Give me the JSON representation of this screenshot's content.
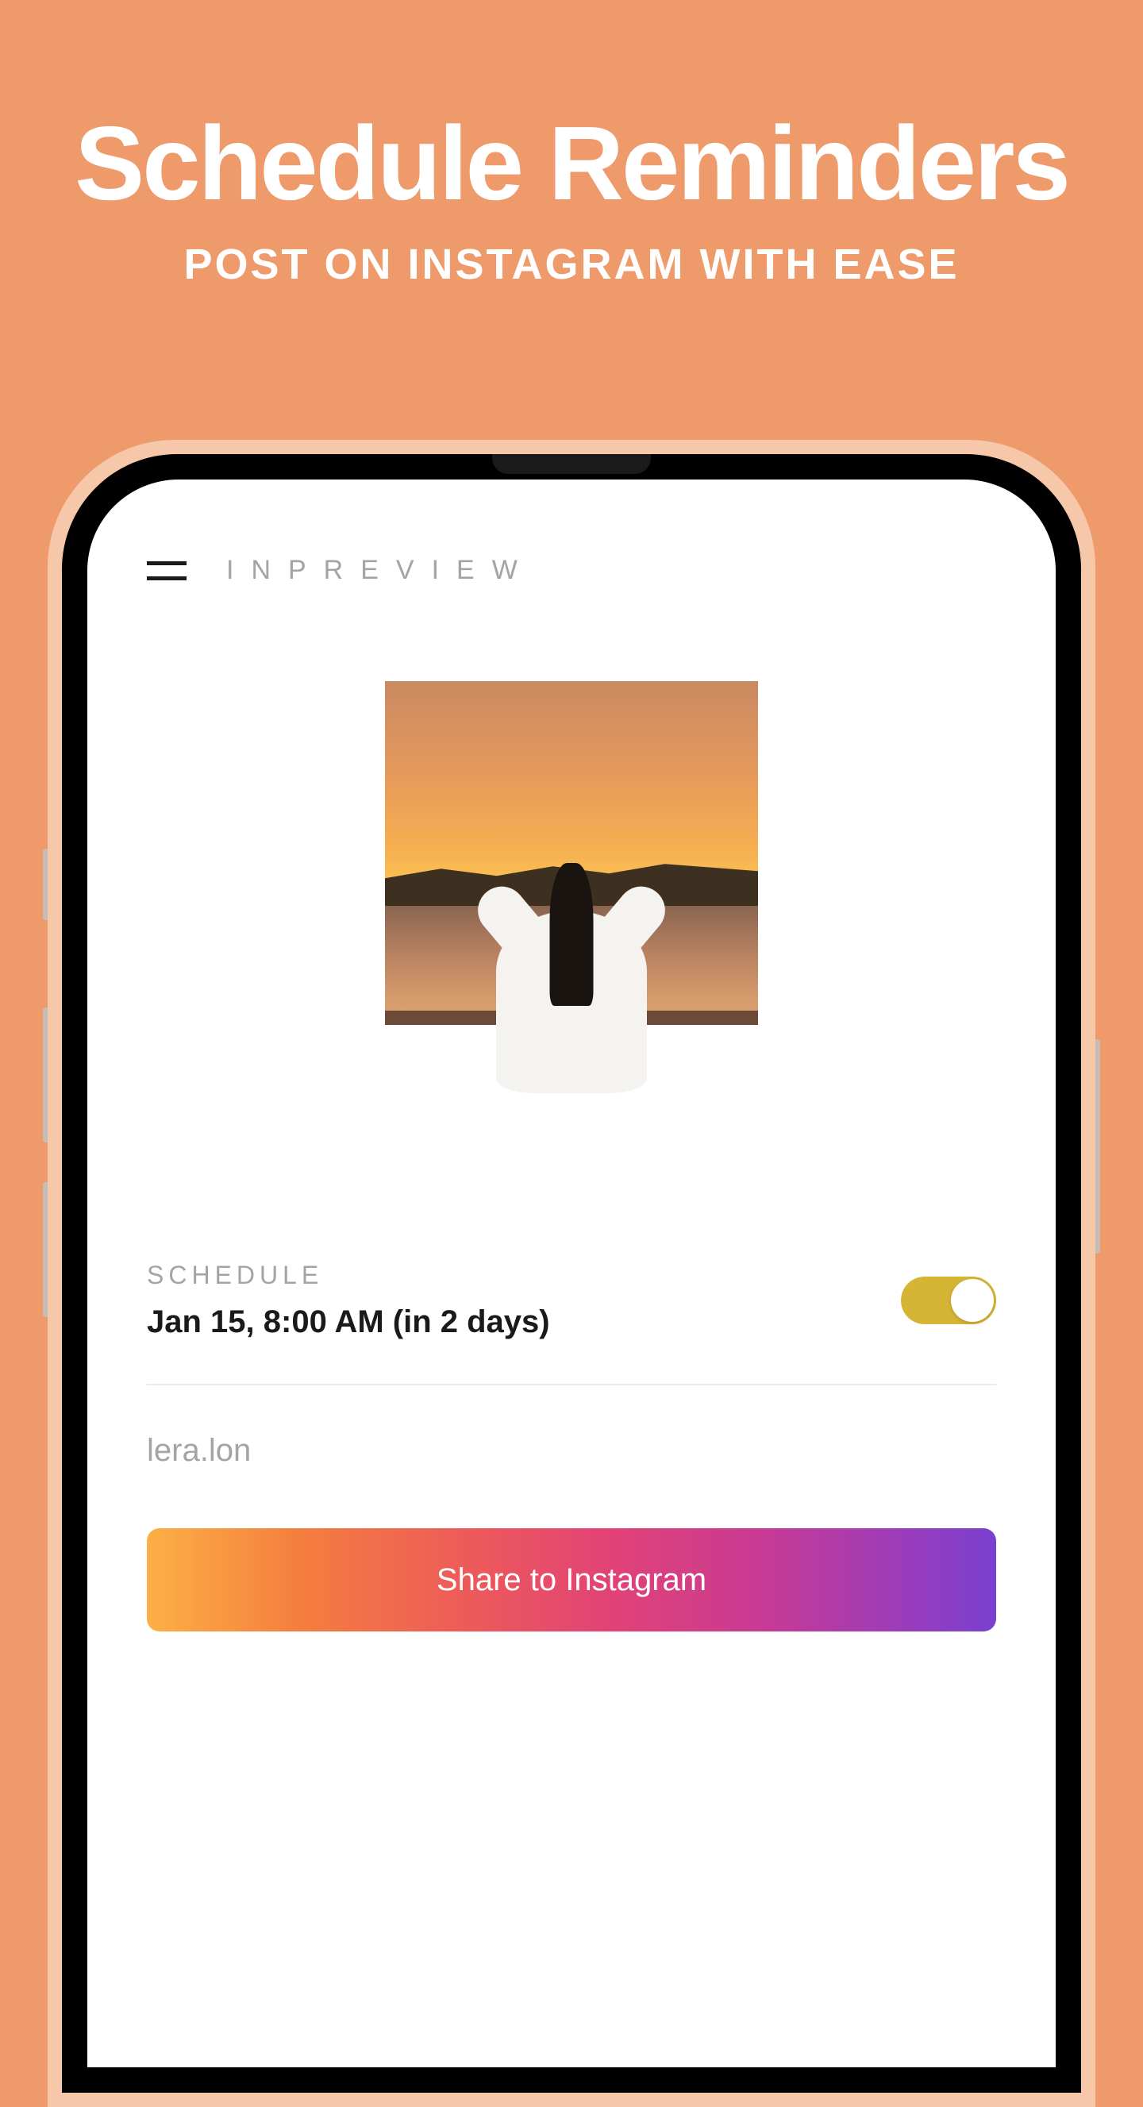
{
  "promo": {
    "title": "Schedule Reminders",
    "subtitle": "POST ON INSTAGRAM WITH EASE"
  },
  "app": {
    "title": "INPREVIEW"
  },
  "schedule": {
    "label": "SCHEDULE",
    "datetime": "Jan 15, 8:00 AM (in 2 days)",
    "toggle_on": true
  },
  "caption": {
    "text": "lera.lon"
  },
  "share_button": {
    "label": "Share to Instagram"
  }
}
